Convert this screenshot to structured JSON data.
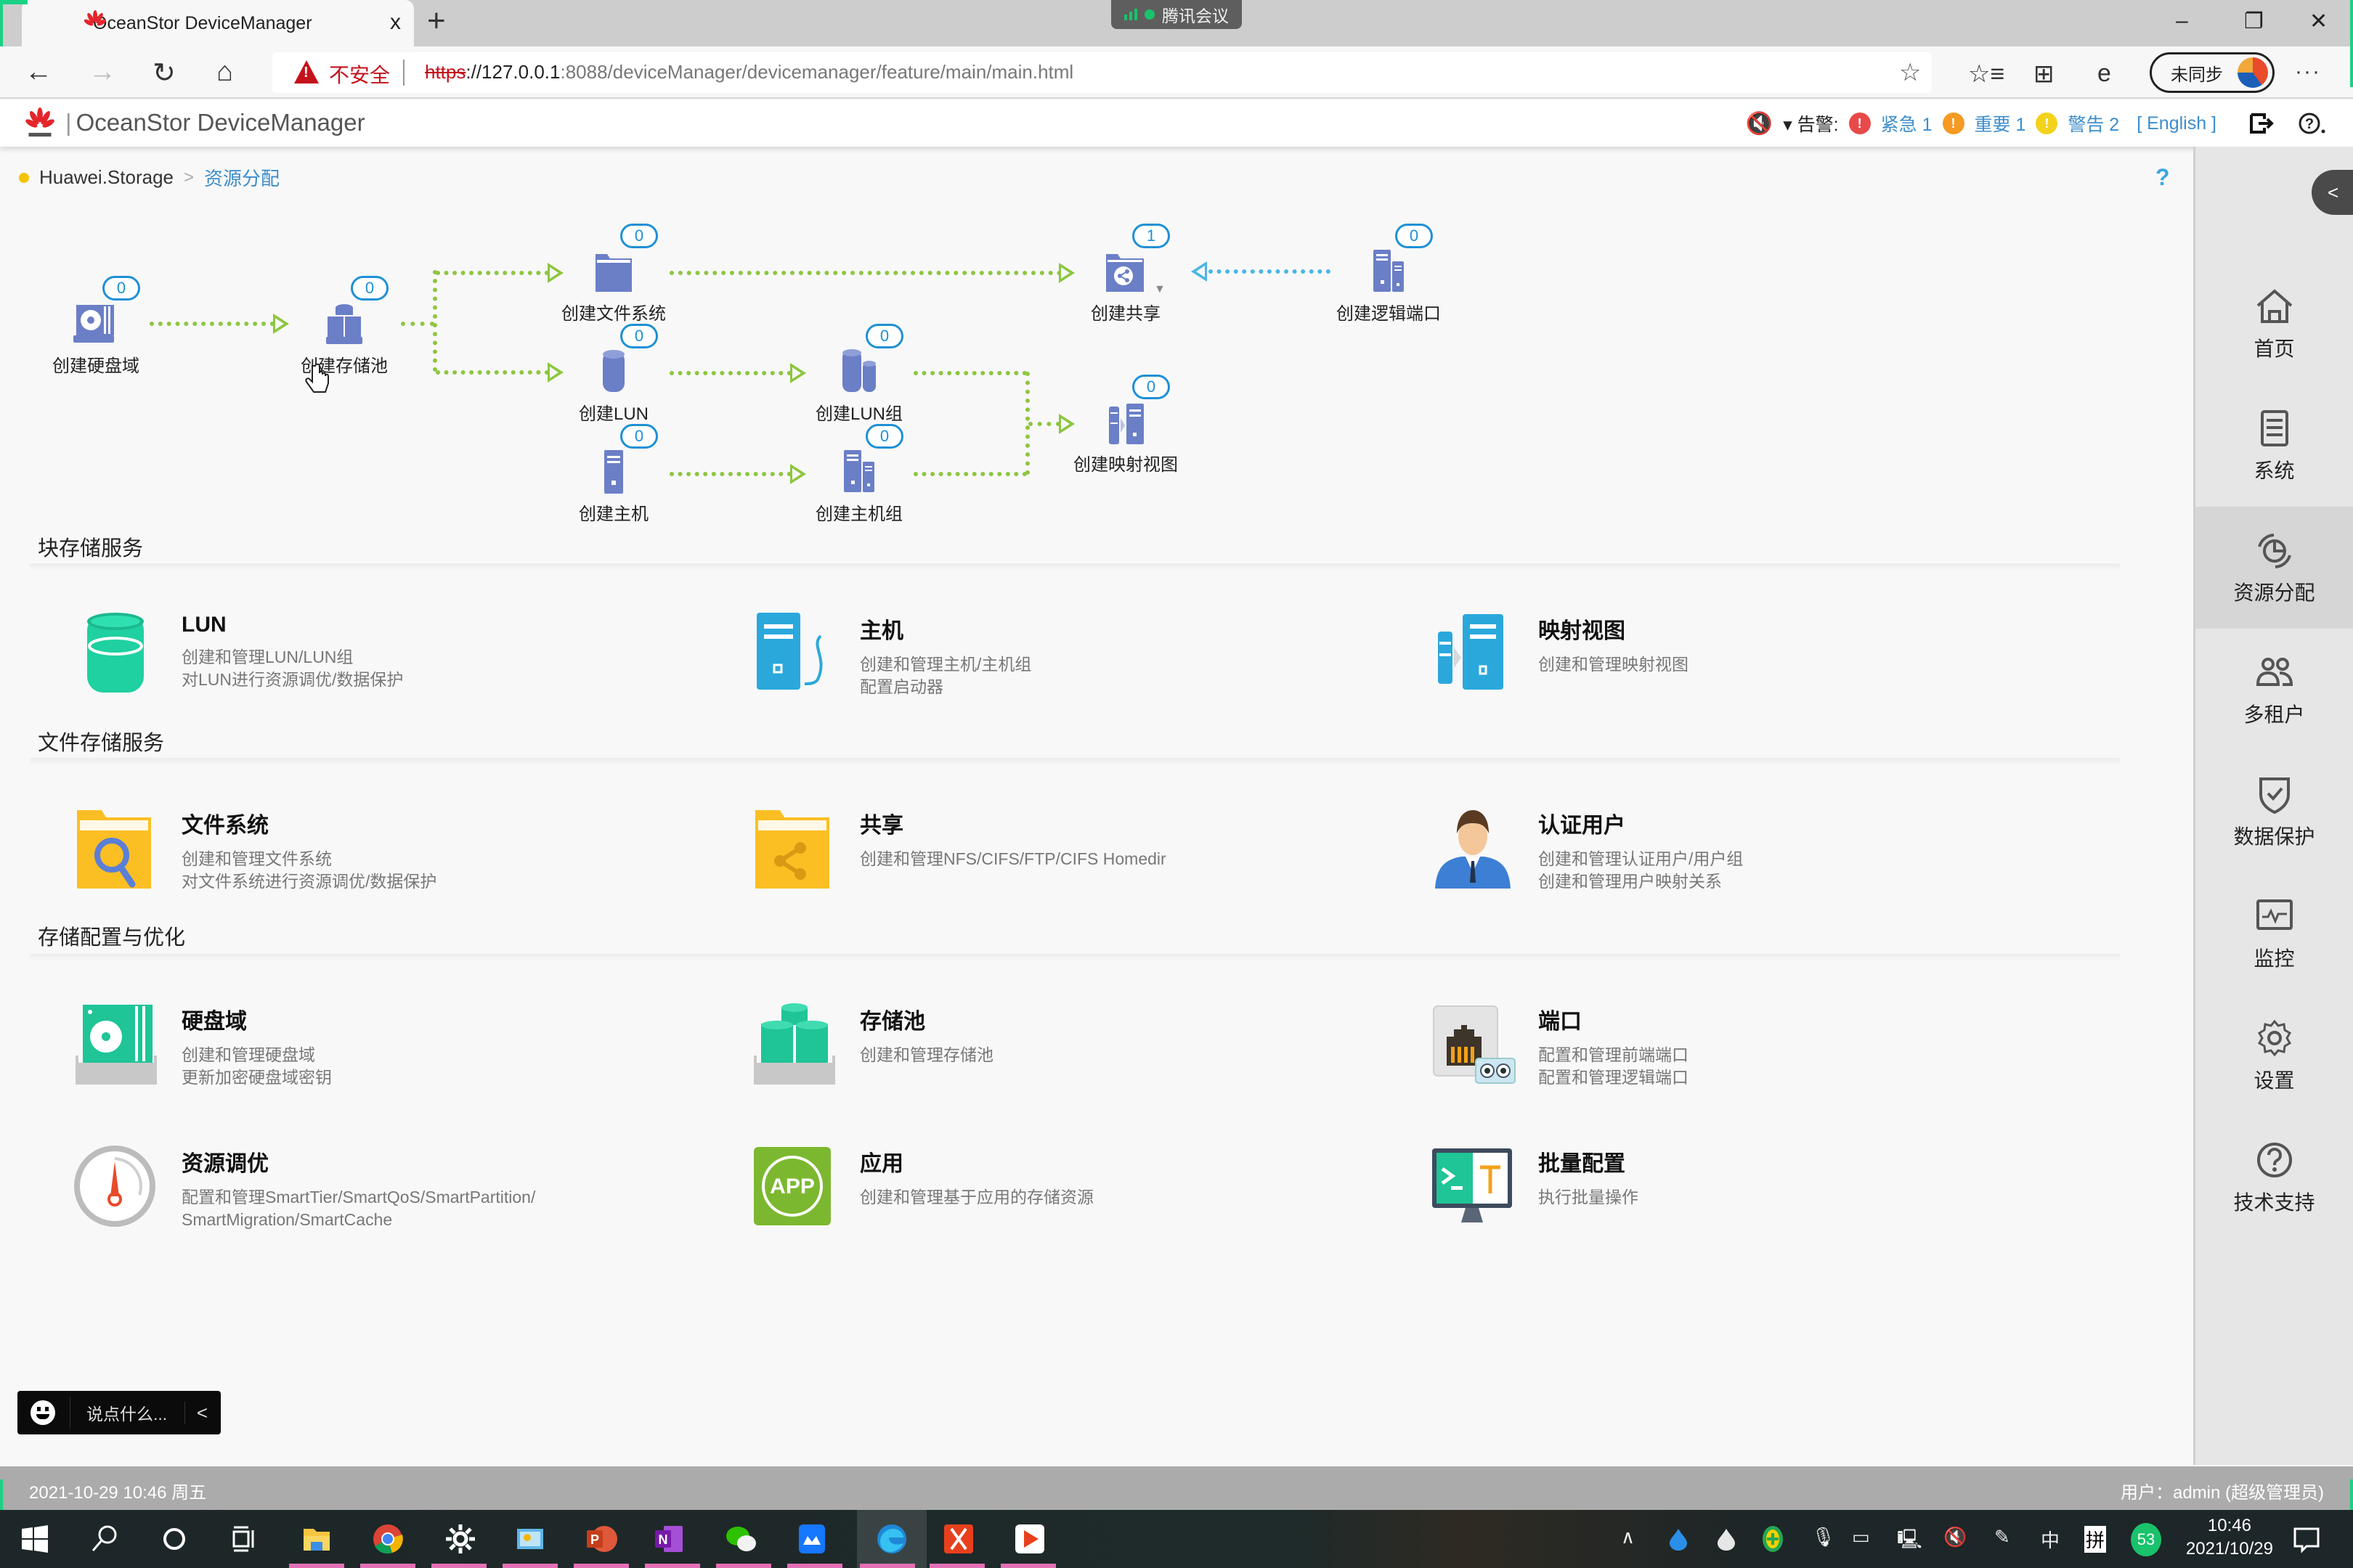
{
  "browser": {
    "tab_title": "OceanStor DeviceManager",
    "tab_close": "x",
    "new_tab": "+",
    "meeting_app": "腾讯会议",
    "window_controls": {
      "minimize": "–",
      "restore": "❐",
      "close": "✕"
    },
    "security_label": "不安全",
    "url_protocol": "https",
    "url_host": "://127.0.0.1",
    "url_rest": ":8088/deviceManager/devicemanager/feature/main/main.html",
    "sync_label": "未同步",
    "more": "···",
    "nav": {
      "back": "←",
      "forward": "→",
      "reload": "↻",
      "home": "⌂"
    },
    "toolbar_icons": [
      "favorite-add-icon",
      "favorites-icon",
      "collections-icon",
      "ie-mode-icon"
    ]
  },
  "app": {
    "name": "OceanStor DeviceManager",
    "alarm_label": "▾ 告警:",
    "alarms": [
      {
        "name": "紧急",
        "count": 1,
        "color": "#e84a4a",
        "label": "紧急 1"
      },
      {
        "name": "重要",
        "count": 1,
        "color": "#f59a23",
        "label": "重要 1"
      },
      {
        "name": "警告",
        "count": 2,
        "color": "#f2d21b",
        "label": "警告 2"
      }
    ],
    "language_link": "[ English ]",
    "accent_color": "#3c8dcc"
  },
  "breadcrumb": {
    "root": "Huawei.Storage",
    "separator": ">",
    "current": "资源分配",
    "help": "?"
  },
  "workflow": {
    "nodes": [
      {
        "id": "disk-domain",
        "label": "创建硬盘域",
        "count": "0"
      },
      {
        "id": "storage-pool",
        "label": "创建存储池",
        "count": "0"
      },
      {
        "id": "file-system",
        "label": "创建文件系统",
        "count": "0"
      },
      {
        "id": "lun",
        "label": "创建LUN",
        "count": "0"
      },
      {
        "id": "host",
        "label": "创建主机",
        "count": "0"
      },
      {
        "id": "share",
        "label": "创建共享",
        "count": "1"
      },
      {
        "id": "logical-port",
        "label": "创建逻辑端口",
        "count": "0"
      },
      {
        "id": "lun-group",
        "label": "创建LUN组",
        "count": "0"
      },
      {
        "id": "host-group",
        "label": "创建主机组",
        "count": "0"
      },
      {
        "id": "mapping-view",
        "label": "创建映射视图",
        "count": "0"
      }
    ]
  },
  "sections": [
    {
      "title": "块存储服务",
      "cards": [
        {
          "title": "LUN",
          "desc": [
            "创建和管理LUN/LUN组",
            "对LUN进行资源调优/数据保护"
          ]
        },
        {
          "title": "主机",
          "desc": [
            "创建和管理主机/主机组",
            "配置启动器"
          ]
        },
        {
          "title": "映射视图",
          "desc": [
            "创建和管理映射视图"
          ]
        }
      ]
    },
    {
      "title": "文件存储服务",
      "cards": [
        {
          "title": "文件系统",
          "desc": [
            "创建和管理文件系统",
            "对文件系统进行资源调优/数据保护"
          ]
        },
        {
          "title": "共享",
          "desc": [
            "创建和管理NFS/CIFS/FTP/CIFS Homedir"
          ]
        },
        {
          "title": "认证用户",
          "desc": [
            "创建和管理认证用户/用户组",
            "创建和管理用户映射关系"
          ]
        }
      ]
    },
    {
      "title": "存储配置与优化",
      "cards": [
        {
          "title": "硬盘域",
          "desc": [
            "创建和管理硬盘域",
            "更新加密硬盘域密钥"
          ]
        },
        {
          "title": "存储池",
          "desc": [
            "创建和管理存储池"
          ]
        },
        {
          "title": "端口",
          "desc": [
            "配置和管理前端端口",
            "配置和管理逻辑端口"
          ]
        },
        {
          "title": "资源调优",
          "desc": [
            "配置和管理SmartTier/SmartQoS/SmartPartition/",
            "SmartMigration/SmartCache"
          ]
        },
        {
          "title": "应用",
          "desc": [
            "创建和管理基于应用的存储资源"
          ]
        },
        {
          "title": "批量配置",
          "desc": [
            "执行批量操作"
          ]
        }
      ]
    }
  ],
  "right_nav": {
    "collapse": "<",
    "items": [
      {
        "label": "首页",
        "icon": "home-icon",
        "active": false
      },
      {
        "label": "系统",
        "icon": "system-icon",
        "active": false
      },
      {
        "label": "资源分配",
        "icon": "resource-allocation-icon",
        "active": true
      },
      {
        "label": "多租户",
        "icon": "multi-tenant-icon",
        "active": false
      },
      {
        "label": "数据保护",
        "icon": "data-protection-icon",
        "active": false
      },
      {
        "label": "监控",
        "icon": "monitor-icon",
        "active": false
      },
      {
        "label": "设置",
        "icon": "settings-icon",
        "active": false
      },
      {
        "label": "技术支持",
        "icon": "support-icon",
        "active": false
      }
    ]
  },
  "chat": {
    "placeholder": "说点什么...",
    "toggle": "<"
  },
  "status": {
    "datetime": "2021-10-29 10:46 周五",
    "user": "用户：admin (超级管理员)"
  },
  "taskbar": {
    "apps": [
      "start",
      "search",
      "cortana",
      "task-view",
      "file-explorer",
      "chrome",
      "settings",
      "control-panel",
      "powerpoint",
      "onenote",
      "wechat",
      "lanxin",
      "edge",
      "xmind",
      "player"
    ],
    "tray": {
      "ime_lang": "中",
      "ime_mode": "拼",
      "badge": "53",
      "time": "10:46",
      "date": "2021/10/29"
    }
  }
}
